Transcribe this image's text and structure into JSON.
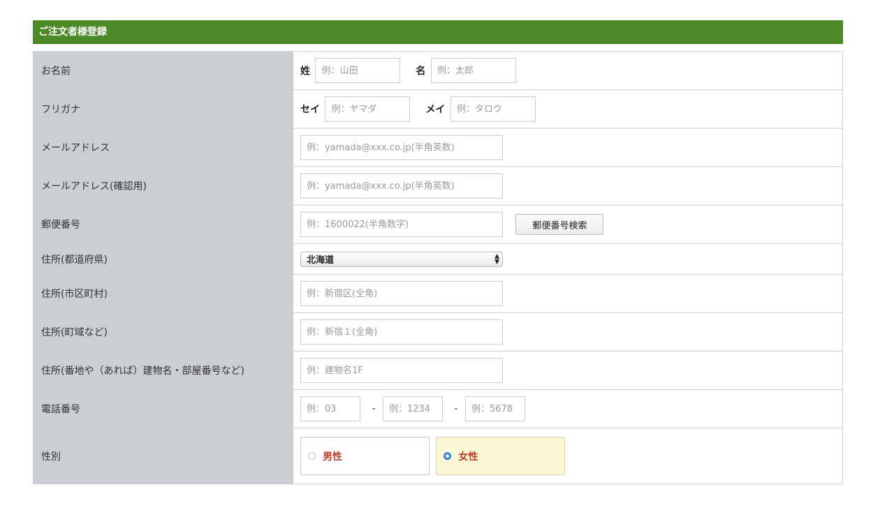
{
  "section_title": "ご注文者様登録",
  "rows": {
    "name": {
      "label": "お名前",
      "last_prefix": "姓",
      "last_placeholder": "例：山田",
      "first_prefix": "名",
      "first_placeholder": "例：太郎"
    },
    "kana": {
      "label": "フリガナ",
      "last_prefix": "セイ",
      "last_placeholder": "例：ヤマダ",
      "first_prefix": "メイ",
      "first_placeholder": "例：タロウ"
    },
    "email": {
      "label": "メールアドレス",
      "placeholder": "例：yamada@xxx.co.jp(半角英数)"
    },
    "email_confirm": {
      "label": "メールアドレス(確認用)",
      "placeholder": "例：yamada@xxx.co.jp(半角英数)"
    },
    "zip": {
      "label": "郵便番号",
      "placeholder": "例：1600022(半角数字)",
      "search_button": "郵便番号検索"
    },
    "prefecture": {
      "label": "住所(都道府県)",
      "selected": "北海道"
    },
    "city": {
      "label": "住所(市区町村)",
      "placeholder": "例：新宿区(全角)"
    },
    "town": {
      "label": "住所(町域など)",
      "placeholder": "例：新宿１(全角)"
    },
    "address": {
      "label": "住所(番地や（あれば）建物名・部屋番号など)",
      "placeholder": "例：建物名1F"
    },
    "phone": {
      "label": "電話番号",
      "p1_placeholder": "例：03",
      "sep": "-",
      "p2_placeholder": "例：1234",
      "p3_placeholder": "例：5678"
    },
    "gender": {
      "label": "性別",
      "male": "男性",
      "female": "女性",
      "selected": "female"
    }
  },
  "colors": {
    "header_bg": "#4c8a27",
    "label_bg": "#cbced2",
    "radio_selected_bg": "#fbf8d6",
    "radio_text": "#c0392b"
  }
}
